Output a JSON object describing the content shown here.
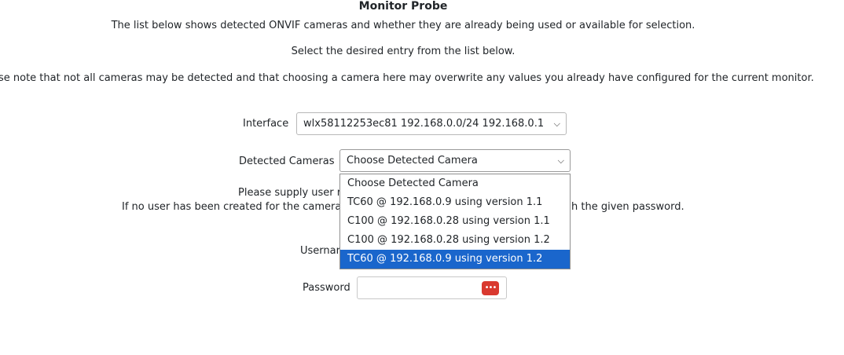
{
  "page": {
    "title": "Monitor Probe",
    "intro_line_1": "The list below shows detected ONVIF cameras and whether they are already being used or available for selection.",
    "intro_line_2": "Select the desired entry from the list below.",
    "intro_line_3": "ase note that not all cameras may be detected and that choosing a camera here may overwrite any values you already have configured for the current monitor."
  },
  "form": {
    "interface": {
      "label": "Interface",
      "selected": "wlx58112253ec81 192.168.0.0/24 192.168.0.1"
    },
    "detected_cameras": {
      "label": "Detected Cameras",
      "selected": "Choose Detected Camera",
      "options": [
        "Choose Detected Camera",
        "TC60 @ 192.168.0.9 using version 1.1",
        "C100 @ 192.168.0.28 using version 1.1",
        "C100 @ 192.168.0.28 using version 1.2",
        "TC60 @ 192.168.0.9 using version 1.2"
      ],
      "highlighted_option": "TC60 @ 192.168.0.9 using version 1.2"
    },
    "credentials_note_line_1_visible": "Please supply user r",
    "credentials_note_line_2_left": "If no user has been created for the camera",
    "credentials_note_line_2_right": "h the given password.",
    "username": {
      "label_visible": "Usernar",
      "value": ""
    },
    "password": {
      "label": "Password",
      "value": "",
      "manager_badge": "•••"
    }
  },
  "icons": {
    "select_chevron": "chevron-down-icon",
    "password_manager": "password-manager-icon"
  },
  "colors": {
    "highlight": "#1a66cc",
    "password_badge": "#d9392f"
  }
}
